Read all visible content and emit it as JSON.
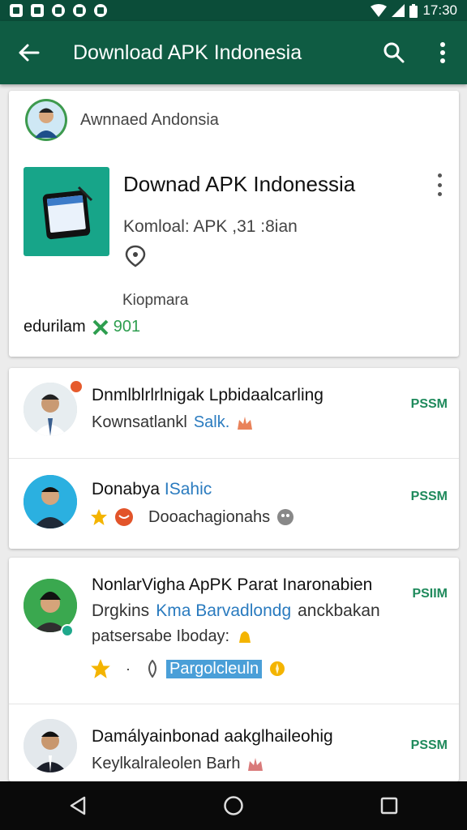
{
  "status_bar": {
    "time": "17:30"
  },
  "app_bar": {
    "title": "Download APK Indonesia"
  },
  "app_card": {
    "developer_name": "Awnnaed Andonsia",
    "title": "Downad APK Indonessia",
    "subtitle": "Komloal: APK ,31 :8ian",
    "label": "Kiopmara",
    "stat_label": "edurilam",
    "stat_value": "901"
  },
  "reviews_card_1": [
    {
      "title": "Dnmlblrlrlnigak Lpbidaalcarling",
      "line1": "Kownsatlankl",
      "line1_blue": "Salk.",
      "badge": "PSSM"
    },
    {
      "title": "Donabya",
      "title_blue": "ISahic",
      "line1": "Dooachagionahs",
      "badge": "PSSM"
    }
  ],
  "reviews_card_2": [
    {
      "title": "NonlarVigha ApPK Parat Inaronabien",
      "line1_start": "Drgkins",
      "line1_blue": "Kma Barvadlondg",
      "line1_end": "anckbakan",
      "line2": "patsersabe Iboday:",
      "highlight": "Pargolcleuln",
      "badge": "PSIIM"
    },
    {
      "title": "Damályainbonad aakglhaileohig",
      "line1": "Keylkalraleolen Barh",
      "badge": "PSSM"
    }
  ],
  "icons": {
    "back": "arrow-left-icon",
    "search": "search-icon",
    "more": "more-vert-icon",
    "nav_back": "triangle-back-icon",
    "nav_home": "circle-home-icon",
    "nav_recents": "square-recents-icon"
  },
  "colors": {
    "status_bar": "#0b4d39",
    "app_bar": "#0f5c43",
    "accent_green": "#2e9e4f",
    "link_blue": "#2a7bbf"
  }
}
